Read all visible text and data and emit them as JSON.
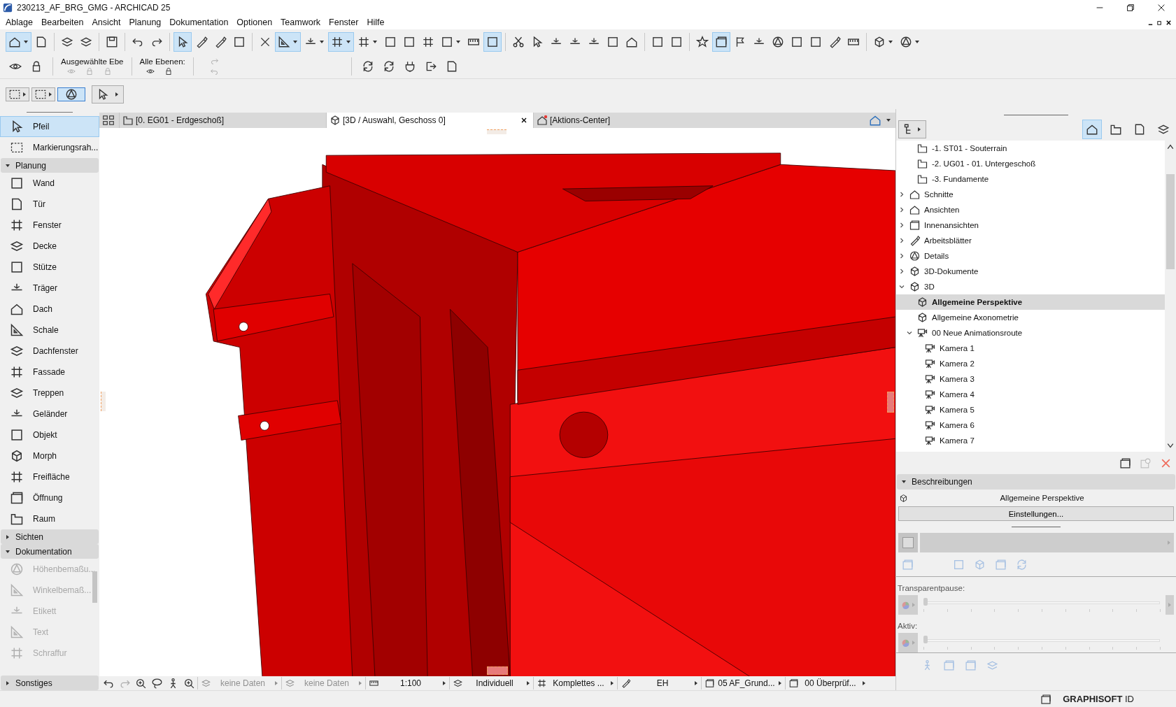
{
  "window": {
    "title": "230213_AF_BRG_GMG - ARCHICAD 25"
  },
  "menu": [
    "Ablage",
    "Bearbeiten",
    "Ansicht",
    "Planung",
    "Dokumentation",
    "Optionen",
    "Teamwork",
    "Fenster",
    "Hilfe"
  ],
  "toolbar_groups": [
    {
      "buttons": [
        {
          "selected": true,
          "dropdown": true
        },
        {
          "selected": false,
          "dropdown": false
        }
      ]
    },
    {
      "buttons": [
        {
          "selected": false,
          "dropdown": false
        },
        {
          "selected": false,
          "dropdown": false
        }
      ]
    },
    {
      "buttons": [
        {
          "selected": false,
          "dropdown": false
        }
      ]
    },
    {
      "buttons": [
        {
          "selected": false,
          "dropdown": false
        },
        {
          "selected": false,
          "dropdown": false
        }
      ]
    },
    {
      "buttons": [
        {
          "selected": true,
          "dropdown": false
        },
        {
          "selected": false,
          "dropdown": false
        },
        {
          "selected": false,
          "dropdown": false
        },
        {
          "selected": false,
          "dropdown": false
        }
      ]
    },
    {
      "buttons": [
        {
          "selected": false,
          "dropdown": false
        },
        {
          "selected": true,
          "dropdown": true
        },
        {
          "selected": false,
          "dropdown": true
        },
        {
          "selected": true,
          "dropdown": true
        },
        {
          "selected": false,
          "dropdown": true
        },
        {
          "selected": false,
          "dropdown": false
        },
        {
          "selected": false,
          "dropdown": false
        },
        {
          "selected": false,
          "dropdown": false
        },
        {
          "selected": false,
          "dropdown": true
        },
        {
          "selected": false,
          "dropdown": false
        },
        {
          "selected": true,
          "dropdown": false
        }
      ]
    },
    {
      "buttons": [
        {
          "selected": false,
          "dropdown": false
        },
        {
          "selected": false,
          "dropdown": false
        },
        {
          "selected": false,
          "dropdown": false
        },
        {
          "selected": false,
          "dropdown": false
        },
        {
          "selected": false,
          "dropdown": false
        },
        {
          "selected": false,
          "dropdown": false
        },
        {
          "selected": false,
          "dropdown": false
        }
      ]
    },
    {
      "buttons": [
        {
          "selected": false,
          "dropdown": false
        },
        {
          "selected": false,
          "dropdown": false
        }
      ]
    },
    {
      "buttons": [
        {
          "selected": false,
          "dropdown": false
        },
        {
          "selected": true,
          "dropdown": false
        },
        {
          "selected": false,
          "dropdown": false
        },
        {
          "selected": false,
          "dropdown": false
        },
        {
          "selected": false,
          "dropdown": false
        },
        {
          "selected": false,
          "dropdown": false
        },
        {
          "selected": false,
          "dropdown": false
        },
        {
          "selected": false,
          "dropdown": false
        },
        {
          "selected": false,
          "dropdown": false
        }
      ]
    },
    {
      "buttons": [
        {
          "selected": false,
          "dropdown": true
        },
        {
          "selected": false,
          "dropdown": true
        }
      ]
    }
  ],
  "layer_bar": {
    "labels": [
      "Ausgewählte Ebe",
      "Alle Ebenen:"
    ]
  },
  "selection_bar": [
    {
      "selected": false
    },
    {
      "selected": false
    },
    {
      "selected": true
    },
    {
      "selected": false
    }
  ],
  "toolbox": {
    "top": [
      {
        "label": "Pfeil",
        "selected": true
      },
      {
        "label": "Markierungsrah...",
        "selected": false
      }
    ],
    "sections": [
      {
        "title": "Planung",
        "expanded": true,
        "items": [
          {
            "label": "Wand",
            "selected": false,
            "disabled": false
          },
          {
            "label": "Tür",
            "selected": false,
            "disabled": false
          },
          {
            "label": "Fenster",
            "selected": false,
            "disabled": false
          },
          {
            "label": "Decke",
            "selected": false,
            "disabled": false
          },
          {
            "label": "Stütze",
            "selected": false,
            "disabled": false
          },
          {
            "label": "Träger",
            "selected": false,
            "disabled": false
          },
          {
            "label": "Dach",
            "selected": false,
            "disabled": false
          },
          {
            "label": "Schale",
            "selected": false,
            "disabled": false
          },
          {
            "label": "Dachfenster",
            "selected": false,
            "disabled": false
          },
          {
            "label": "Fassade",
            "selected": false,
            "disabled": false
          },
          {
            "label": "Treppen",
            "selected": false,
            "disabled": false
          },
          {
            "label": "Geländer",
            "selected": false,
            "disabled": false
          },
          {
            "label": "Objekt",
            "selected": false,
            "disabled": false
          },
          {
            "label": "Morph",
            "selected": false,
            "disabled": false
          },
          {
            "label": "Freifläche",
            "selected": false,
            "disabled": false
          },
          {
            "label": "Öffnung",
            "selected": false,
            "disabled": false
          },
          {
            "label": "Raum",
            "selected": false,
            "disabled": false
          }
        ]
      },
      {
        "title": "Sichten",
        "expanded": false
      },
      {
        "title": "Dokumentation",
        "expanded": true,
        "items": [
          {
            "label": "Höhenbemaßu...",
            "selected": false,
            "disabled": true
          },
          {
            "label": "Winkelbemaß...",
            "selected": false,
            "disabled": true
          },
          {
            "label": "Etikett",
            "selected": false,
            "disabled": true
          },
          {
            "label": "Text",
            "selected": false,
            "disabled": true
          },
          {
            "label": "Schraffur",
            "selected": false,
            "disabled": true
          }
        ]
      },
      {
        "title": "Sonstiges",
        "expanded": false
      }
    ]
  },
  "tabs": [
    {
      "label": "[0. EG01 - Erdgeschoß]",
      "selected": false
    },
    {
      "label": "[3D / Auswahl, Geschoss 0]",
      "selected": true
    },
    {
      "label": "[Aktions-Center]",
      "selected": false
    }
  ],
  "status_bar": [
    {
      "label": "keine Daten",
      "disabled": true
    },
    {
      "label": "keine Daten",
      "disabled": true
    },
    {
      "label": "1:100",
      "disabled": false
    },
    {
      "label": "Individuell",
      "disabled": false
    },
    {
      "label": "Komplettes ...",
      "disabled": false
    },
    {
      "label": "EH",
      "disabled": false
    },
    {
      "label": "05 AF_Grund...",
      "disabled": false
    },
    {
      "label": "00 Überprüf...",
      "disabled": false
    }
  ],
  "navigator": {
    "modes": [
      {
        "selected": true
      },
      {
        "selected": false
      },
      {
        "selected": false
      },
      {
        "selected": false
      }
    ],
    "continued_children": [
      {
        "label": "-1. ST01 - Souterrain",
        "selected": false
      },
      {
        "label": "-2. UG01 - 01. Untergeschoß",
        "selected": false
      },
      {
        "label": "-3. Fundamente",
        "selected": false
      }
    ],
    "items": [
      {
        "label": "Schnitte",
        "expanded": false,
        "selected": false
      },
      {
        "label": "Ansichten",
        "expanded": false,
        "selected": false
      },
      {
        "label": "Innenansichten",
        "expanded": false,
        "selected": false
      },
      {
        "label": "Arbeitsblätter",
        "expanded": false,
        "selected": false
      },
      {
        "label": "Details",
        "expanded": false,
        "selected": false
      },
      {
        "label": "3D-Dokumente",
        "expanded": false,
        "selected": false
      },
      {
        "label": "3D",
        "expanded": true,
        "selected": false,
        "children": [
          {
            "label": "Allgemeine Perspektive",
            "selected": true
          },
          {
            "label": "Allgemeine Axonometrie",
            "selected": false
          },
          {
            "label": "00 Neue Animationsroute",
            "expanded": true,
            "selected": false,
            "children": [
              {
                "label": "Kamera 1",
                "selected": false
              },
              {
                "label": "Kamera 2",
                "selected": false
              },
              {
                "label": "Kamera 3",
                "selected": false
              },
              {
                "label": "Kamera 4",
                "selected": false
              },
              {
                "label": "Kamera 5",
                "selected": false
              },
              {
                "label": "Kamera 6",
                "selected": false
              },
              {
                "label": "Kamera 7",
                "selected": false
              }
            ]
          }
        ]
      }
    ]
  },
  "descriptions": {
    "title": "Beschreibungen",
    "expanded": true,
    "view_name": "Allgemeine Perspektive",
    "settings_button": "Einstellungen..."
  },
  "sliders": [
    {
      "label": "Transparentpause:",
      "level": 0
    },
    {
      "label": "Aktiv:",
      "level": 0
    }
  ],
  "footer": {
    "account": "**GRAPHISOFT** ID"
  }
}
